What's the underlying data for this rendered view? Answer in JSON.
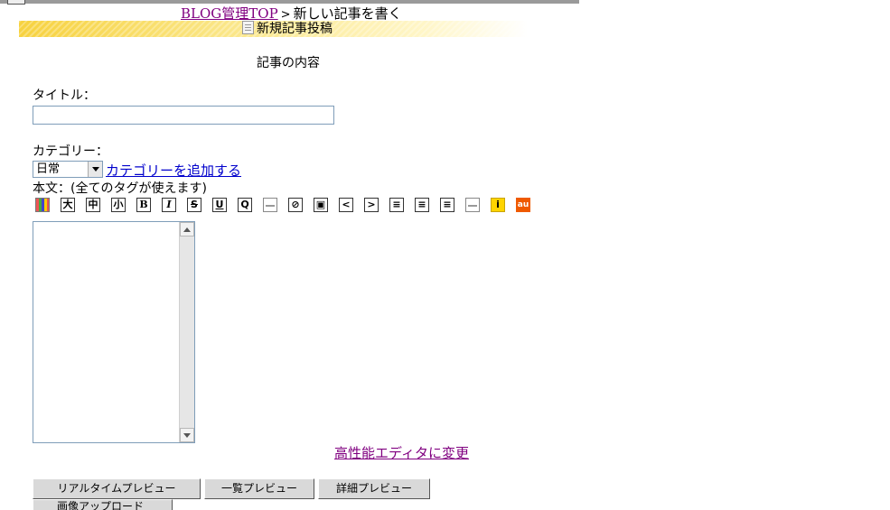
{
  "breadcrumb": {
    "home_link": "BLOG管理TOP",
    "separator": ">",
    "current": "新しい記事を書く"
  },
  "header_band": {
    "title": "新規記事投稿"
  },
  "section_title": "記事の内容",
  "title_field": {
    "label": "タイトル：",
    "value": ""
  },
  "category": {
    "label": "カテゴリー：",
    "selected": "日常",
    "add_link": "カテゴリーを追加する"
  },
  "body": {
    "label": "本文：(全てのタグが使えます)",
    "value": ""
  },
  "toolbar": {
    "buttons": [
      {
        "name": "color-palette-button",
        "text": ""
      },
      {
        "name": "font-large-button",
        "text": "大"
      },
      {
        "name": "font-medium-button",
        "text": "中"
      },
      {
        "name": "font-small-button",
        "text": "小"
      },
      {
        "name": "bold-button",
        "text": "B"
      },
      {
        "name": "italic-button",
        "text": "I"
      },
      {
        "name": "strikethrough-button",
        "text": "S"
      },
      {
        "name": "underline-button",
        "text": "U"
      },
      {
        "name": "quote-button",
        "text": "Q"
      },
      {
        "name": "horizontal-rule-button",
        "text": "—"
      },
      {
        "name": "link-button",
        "text": "⊘"
      },
      {
        "name": "image-button",
        "text": "▣"
      },
      {
        "name": "arrow-left-button",
        "text": "<"
      },
      {
        "name": "arrow-right-button",
        "text": ">"
      },
      {
        "name": "align-left-button",
        "text": "≡"
      },
      {
        "name": "align-right-button",
        "text": "≡"
      },
      {
        "name": "align-center-button",
        "text": "≡"
      },
      {
        "name": "hr-line-button",
        "text": ""
      },
      {
        "name": "mobile-emoji-button",
        "text": "i"
      },
      {
        "name": "au-emoji-button",
        "text": "au"
      }
    ]
  },
  "advanced_editor_link": "高性能エディタに変更",
  "preview_buttons": {
    "realtime": "リアルタイムプレビュー",
    "list": "一覧プレビュー",
    "detail": "詳細プレビュー",
    "partial": "画像アップロード"
  },
  "colors": {
    "link": "#0000cc",
    "visited_link": "#800080",
    "band": "#f7d23f"
  }
}
